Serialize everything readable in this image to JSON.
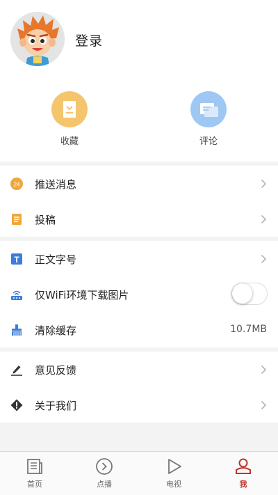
{
  "profile": {
    "login_label": "登录"
  },
  "quick_actions": [
    {
      "label": "收藏",
      "icon": "bookmark-icon"
    },
    {
      "label": "评论",
      "icon": "comment-icon"
    }
  ],
  "settings": {
    "push_label": "推送消息",
    "push_badge": "24",
    "submit_label": "投稿",
    "font_size_label": "正文字号",
    "font_icon_text": "T",
    "wifi_images_label": "仅WiFi环境下载图片",
    "wifi_images_enabled": false,
    "clear_cache_label": "清除缓存",
    "cache_size": "10.7MB",
    "feedback_label": "意见反馈",
    "about_label": "关于我们"
  },
  "tabbar": {
    "items": [
      {
        "label": "首页",
        "icon": "newspaper-icon"
      },
      {
        "label": "点播",
        "icon": "play-circle-icon"
      },
      {
        "label": "电视",
        "icon": "play-triangle-icon"
      },
      {
        "label": "我",
        "icon": "person-icon"
      }
    ],
    "active_index": 3
  },
  "colors": {
    "accent": "#c0322b",
    "favorite_circle": "#f5c56e",
    "comment_circle": "#9fc7f3",
    "icon_orange": "#f0a73a",
    "icon_blue": "#3c7dd9"
  }
}
